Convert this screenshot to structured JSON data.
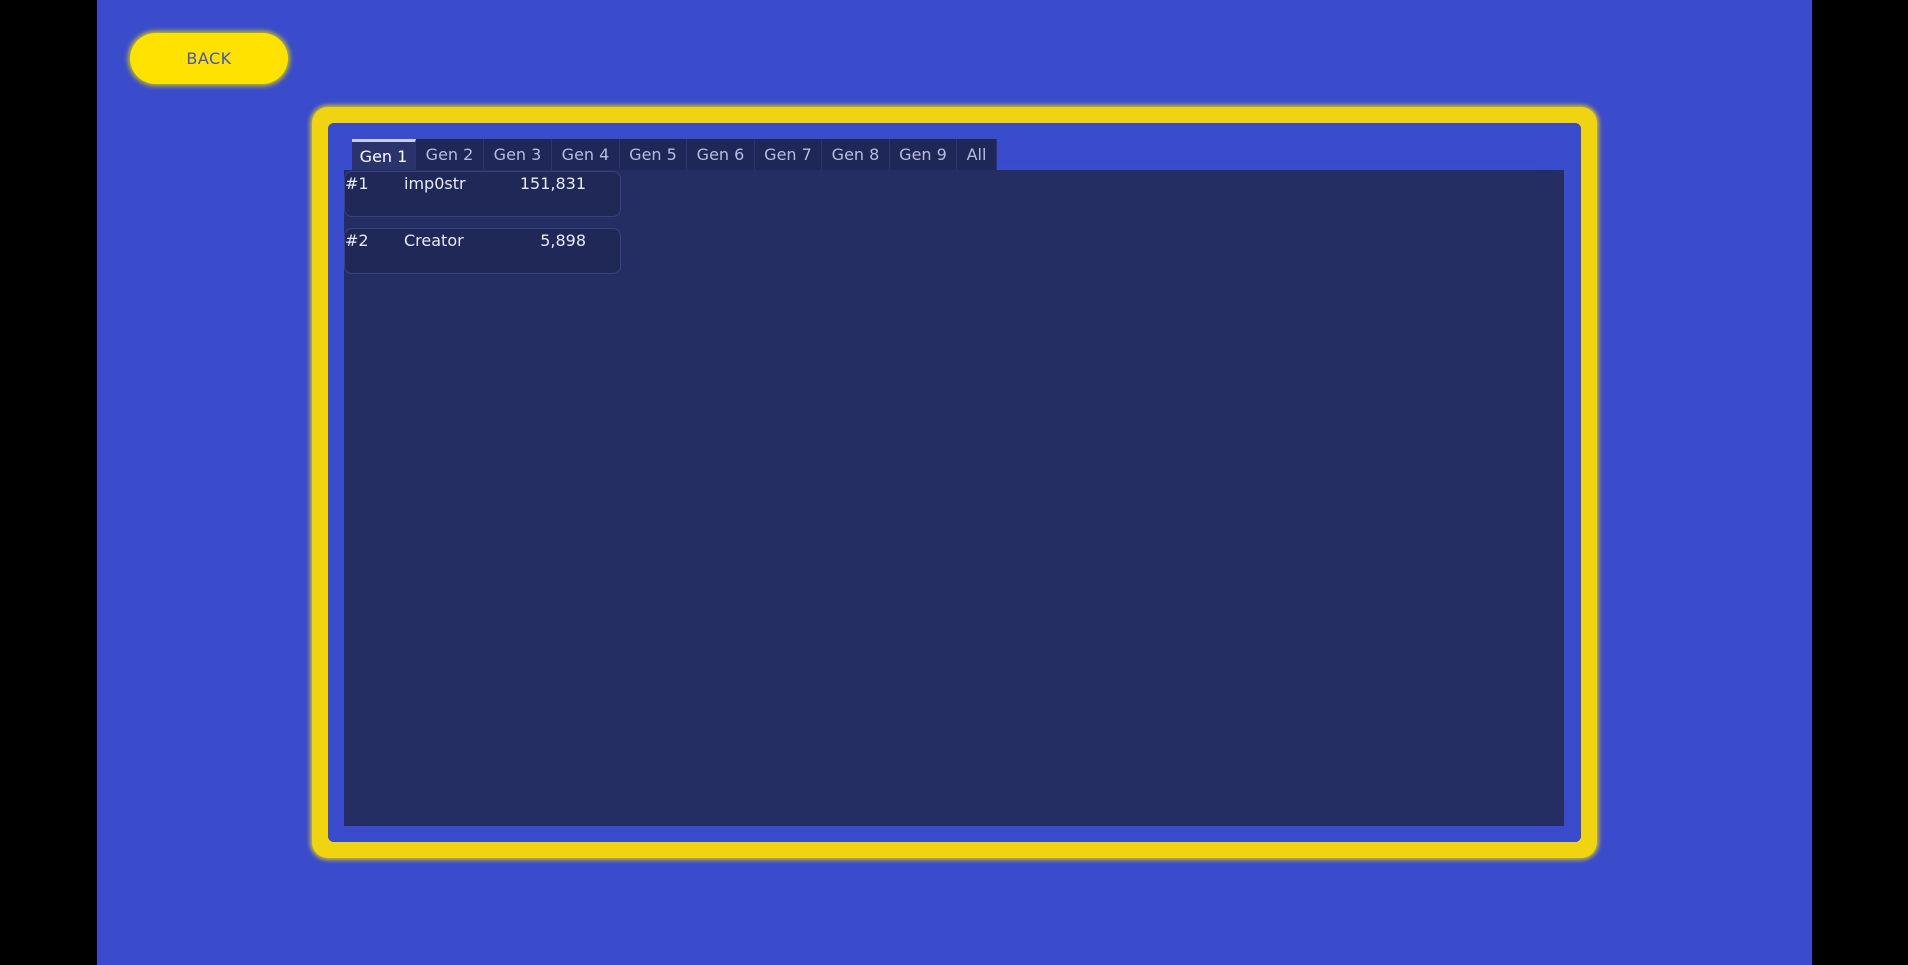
{
  "back_button": {
    "label": "BACK"
  },
  "tabs": [
    {
      "label": "Gen 1",
      "active": true
    },
    {
      "label": "Gen 2",
      "active": false
    },
    {
      "label": "Gen 3",
      "active": false
    },
    {
      "label": "Gen 4",
      "active": false
    },
    {
      "label": "Gen 5",
      "active": false
    },
    {
      "label": "Gen 6",
      "active": false
    },
    {
      "label": "Gen 7",
      "active": false
    },
    {
      "label": "Gen 8",
      "active": false
    },
    {
      "label": "Gen 9",
      "active": false
    },
    {
      "label": "All",
      "active": false
    }
  ],
  "leaderboard": [
    {
      "rank": "#1",
      "name": "imp0str",
      "score": "151,831"
    },
    {
      "rank": "#2",
      "name": "Creator",
      "score": "5,898"
    }
  ],
  "colors": {
    "background": "#3a4ccc",
    "accent_yellow": "#ffe200",
    "panel": "#252e62"
  }
}
